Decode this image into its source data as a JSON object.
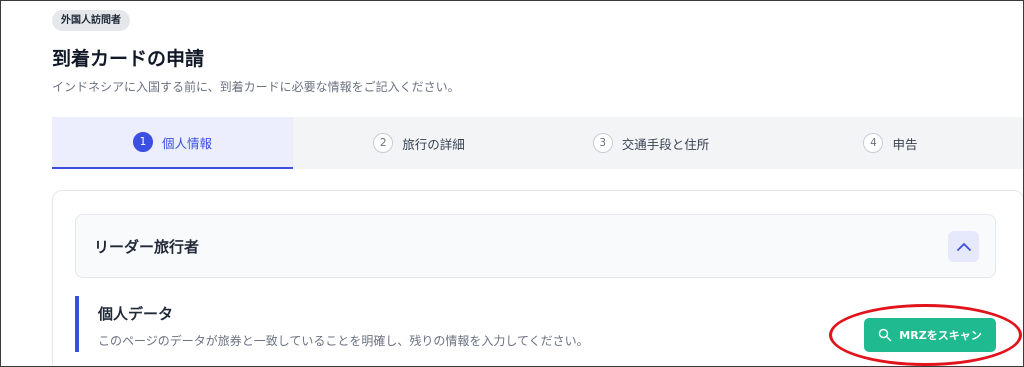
{
  "header": {
    "badge": "外国人訪問者",
    "title": "到着カードの申請",
    "subtitle": "インドネシアに入国する前に、到着カードに必要な情報をご記入ください。"
  },
  "steps": [
    {
      "number": "1",
      "label": "個人情報",
      "active": true
    },
    {
      "number": "2",
      "label": "旅行の詳細",
      "active": false
    },
    {
      "number": "3",
      "label": "交通手段と住所",
      "active": false
    },
    {
      "number": "4",
      "label": "申告",
      "active": false
    }
  ],
  "accordion": {
    "title": "リーダー旅行者",
    "toggle_icon": "chevron-up-icon"
  },
  "section": {
    "title": "個人データ",
    "description": "このページのデータが旅券と一致していることを明確し、残りの情報を入力してください。"
  },
  "scan_button": {
    "label": "MRZをスキャン",
    "icon": "search-icon"
  },
  "colors": {
    "accent": "#3b4fe0",
    "scan_button": "#1fba8f",
    "highlight": "#e1141c"
  }
}
